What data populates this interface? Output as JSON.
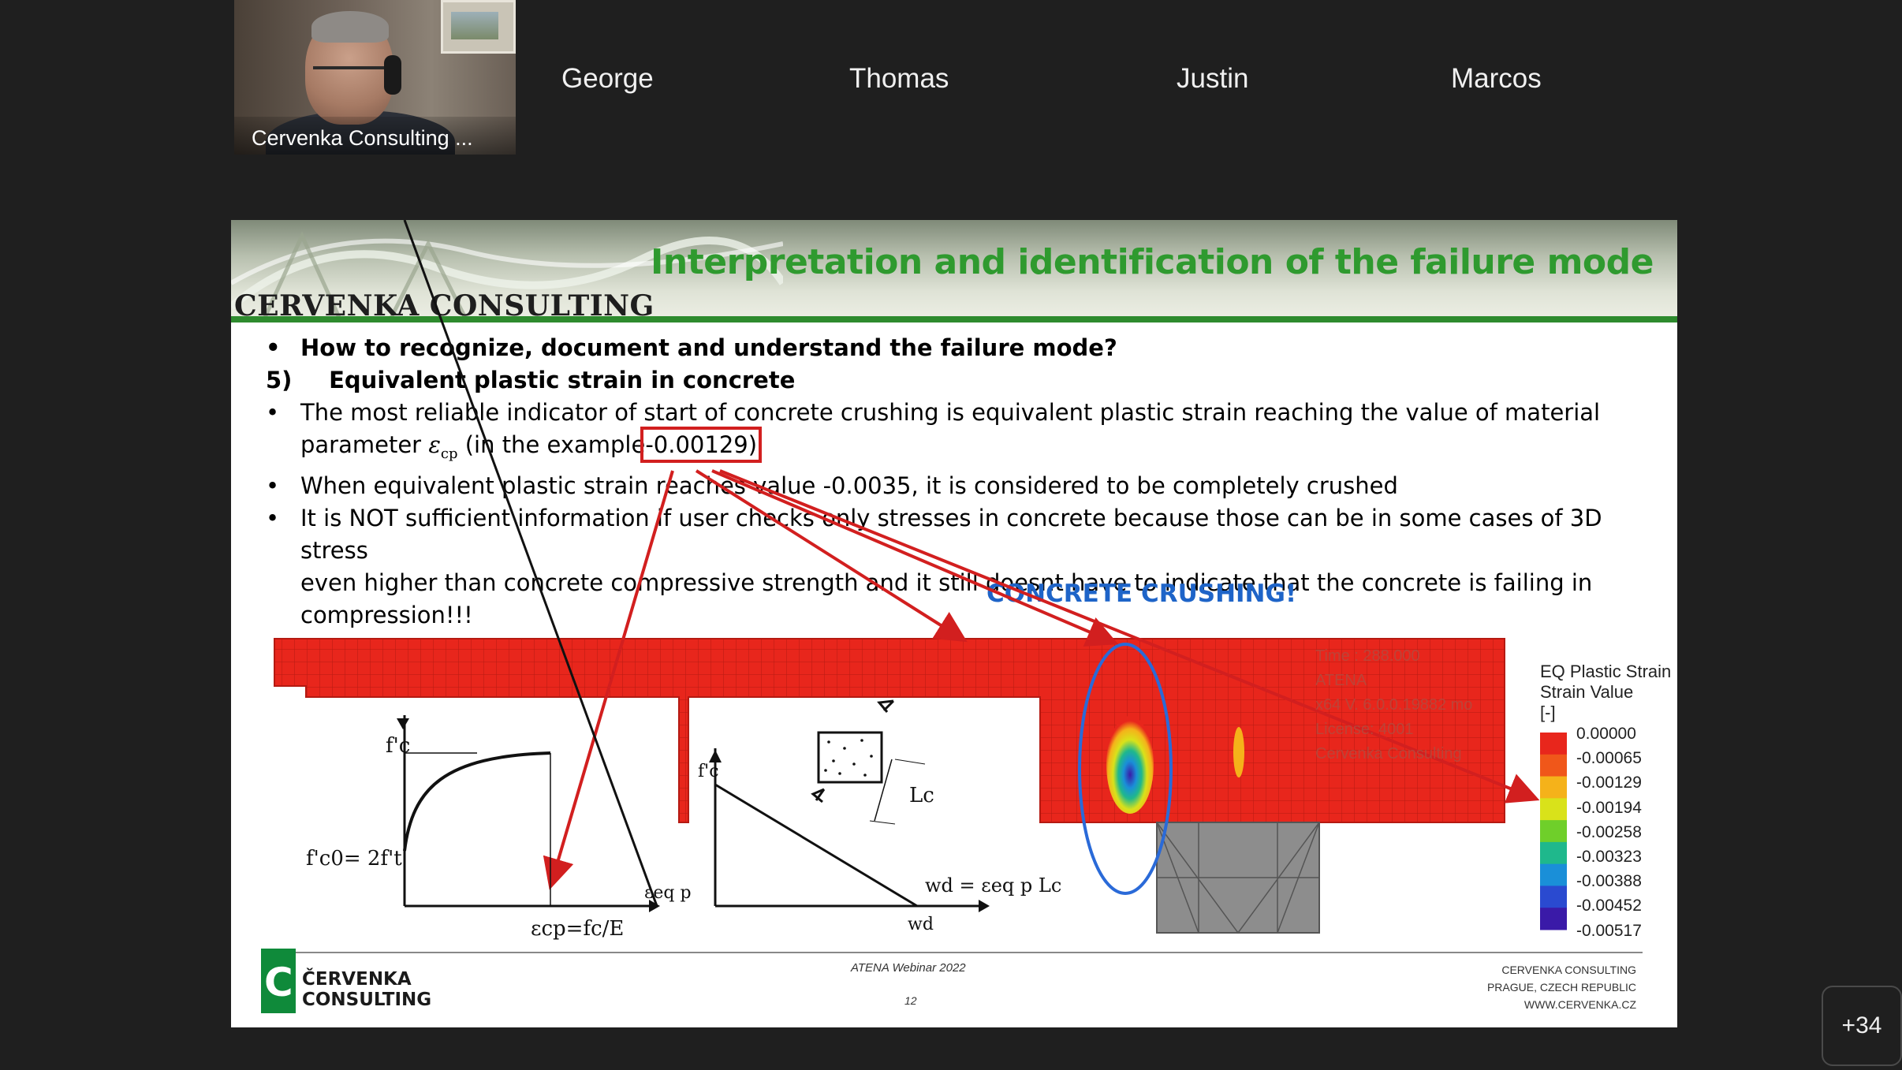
{
  "meeting": {
    "presenter_label": "Cervenka Consulting ...",
    "participants": [
      "George",
      "Thomas",
      "Justin",
      "Marcos"
    ],
    "more_count": "+34"
  },
  "slide": {
    "title": "Interpretation and identification of the failure mode",
    "brand": "CERVENKA CONSULTING",
    "bullet_mark": "•",
    "bullet1": "How to recognize, document and understand the failure mode?",
    "step_num": "5)",
    "step_text": "Equivalent plastic strain in concrete",
    "b2_line1": "The most reliable indicator of start of concrete crushing is equivalent plastic strain reaching the value of material",
    "b2_pre": "parameter",
    "b2_symbol": "ε",
    "b2_sub": "cp",
    "b2_mid": "(in the example",
    "b2_value": "-0.00129)",
    "b3": "When equivalent plastic strain reaches value -0.0035, it is considered to be completely crushed",
    "b4_line1": "It is NOT sufficient information if user checks only stresses in concrete because those can be in some cases of 3D stress",
    "b4_line2": "even higher than concrete compressive strength and it still doesnt have to indicate that the concrete is failing in",
    "b4_line3": "compression!!!",
    "crushing_label": "CONCRETE CRUSHING!",
    "model_overlay": [
      "Time : 288.000",
      "ATENA",
      "x64 V. 6.0.0.19882 mo",
      "License: 4001",
      "Cervenka Consulting"
    ],
    "curve1": {
      "y_label": "f'c",
      "eq_label": "f'c0= 2f't",
      "x_label": "εeq p",
      "bottom_label": "εcp=fc/E"
    },
    "curve2": {
      "y_label": "f'c",
      "x_label": "wd",
      "eq_label": "wd = εeq p Lc",
      "lc_label": "Lc"
    },
    "legend": {
      "title1": "EQ Plastic Strain",
      "title2": "Strain Value",
      "unit": "[-]",
      "values": [
        "0.00000",
        "-0.00065",
        "-0.00129",
        "-0.00194",
        "-0.00258",
        "-0.00323",
        "-0.00388",
        "-0.00452",
        "-0.00517"
      ],
      "colors": [
        "#e8261c",
        "#f0571a",
        "#f5b21a",
        "#d9e21a",
        "#6fcf2a",
        "#1fb88c",
        "#1a8fd8",
        "#2a4ad0",
        "#3a1aa8"
      ]
    },
    "footer": {
      "company_line1": "ČERVENKA",
      "company_line2": "CONSULTING",
      "center": "ATENA Webinar 2022",
      "page": "12",
      "right1": "CERVENKA CONSULTING",
      "right2": "PRAGUE, CZECH REPUBLIC",
      "right3": "WWW.CERVENKA.CZ"
    }
  }
}
